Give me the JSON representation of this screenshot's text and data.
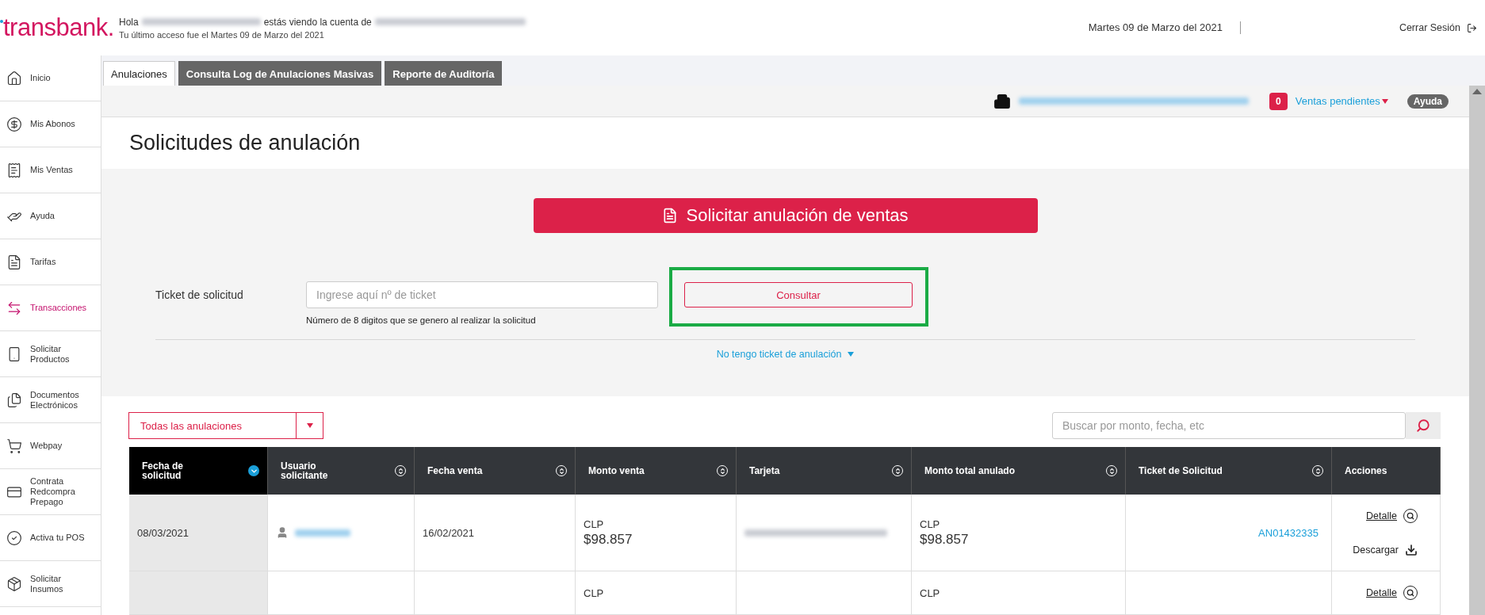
{
  "header": {
    "logo": "transbank.",
    "greeting_prefix": "Hola",
    "greeting_middle": "estás viendo la cuenta de",
    "last_access": "Tu último acceso fue el Martes 09 de Marzo del 2021",
    "date": "Martes 09 de Marzo del 2021",
    "logout": "Cerrar Sesión"
  },
  "sidebar": {
    "items": [
      {
        "label": "Inicio",
        "selected": false
      },
      {
        "label": "Mis Abonos",
        "selected": false
      },
      {
        "label": "Mis Ventas",
        "selected": false
      },
      {
        "label": "Ayuda",
        "selected": false
      },
      {
        "label": "Tarifas",
        "selected": false
      },
      {
        "label": "Transacciones",
        "selected": true
      },
      {
        "label": "Solicitar Productos",
        "selected": false
      },
      {
        "label": "Documentos Electrónicos",
        "selected": false
      },
      {
        "label": "Webpay",
        "selected": false
      },
      {
        "label": "Contrata Redcompra Prepago",
        "selected": false
      },
      {
        "label": "Activa tu POS",
        "selected": false
      },
      {
        "label": "Solicitar Insumos",
        "selected": false
      }
    ]
  },
  "tabs": [
    {
      "label": "Anulaciones",
      "selected": true
    },
    {
      "label": "Consulta Log de Anulaciones Masivas",
      "selected": false
    },
    {
      "label": "Reporte de Auditoría",
      "selected": false
    }
  ],
  "subheader": {
    "pending_count": "0",
    "pending_label": "Ventas pendientes",
    "help": "Ayuda"
  },
  "title": "Solicitudes de anulación",
  "request_button": "Solicitar anulación de ventas",
  "ticket": {
    "label": "Ticket de solicitud",
    "placeholder": "Ingrese aquí nº de ticket",
    "hint": "Número de 8 digitos que se genero al realizar la solicitud",
    "consult_button": "Consultar",
    "highlighted": true,
    "no_ticket_link": "No tengo ticket de anulación"
  },
  "filter": {
    "value": "Todas las anulaciones"
  },
  "search": {
    "placeholder": "Buscar por monto, fecha, etc"
  },
  "table": {
    "columns": [
      {
        "label": "Fecha de solicitud",
        "sortable": true,
        "selected": true
      },
      {
        "label": "Usuario solicitante",
        "sortable": true,
        "selected": false
      },
      {
        "label": "Fecha venta",
        "sortable": true,
        "selected": false
      },
      {
        "label": "Monto venta",
        "sortable": true,
        "selected": false
      },
      {
        "label": "Tarjeta",
        "sortable": true,
        "selected": false
      },
      {
        "label": "Monto total anulado",
        "sortable": true,
        "selected": false
      },
      {
        "label": "Ticket de Solicitud",
        "sortable": true,
        "selected": false
      },
      {
        "label": "Acciones",
        "sortable": false,
        "selected": false
      }
    ],
    "rows": [
      {
        "request_date": "08/03/2021",
        "user_shown": true,
        "sale_date": "16/02/2021",
        "sale_currency": "CLP",
        "sale_amount": "$98.857",
        "card_shown": true,
        "total_currency": "CLP",
        "total_amount": "$98.857",
        "ticket": "AN01432335",
        "detail": "Detalle",
        "download": "Descargar"
      },
      {
        "user_shown": false,
        "card_shown": false,
        "sale_currency": "CLP",
        "total_currency": "CLP",
        "detail": "Detalle"
      }
    ]
  }
}
